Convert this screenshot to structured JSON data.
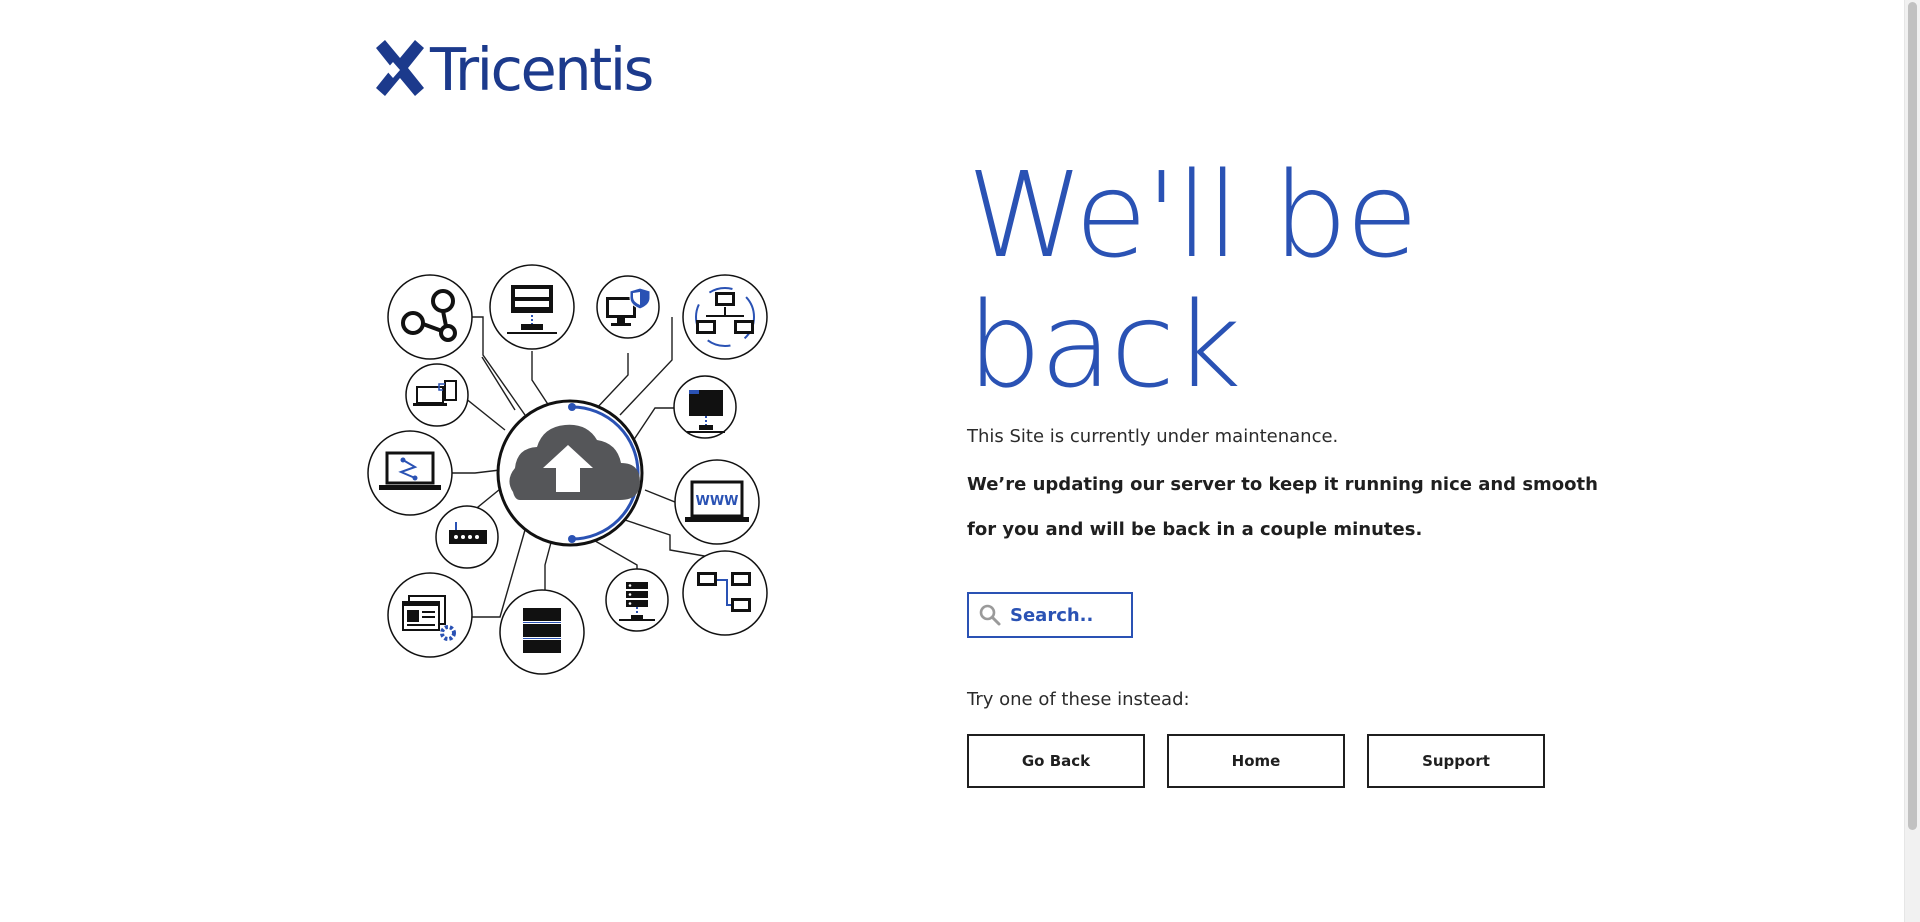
{
  "brand": {
    "name": "Tricentis",
    "color": "#1c3a8c"
  },
  "accent_color": "#2a52b4",
  "headline": {
    "line1": "We'll be",
    "line2": "back"
  },
  "message": {
    "status": "This Site is currently under maintenance.",
    "detail_line1": "We’re updating our server to keep it running nice and smooth",
    "detail_line2": "for you and will be back in a couple minutes."
  },
  "search": {
    "placeholder": "Search..",
    "icon": "search-icon"
  },
  "alternatives": {
    "prompt": "Try one of these instead:",
    "buttons": [
      {
        "label": "Go Back"
      },
      {
        "label": "Home"
      },
      {
        "label": "Support"
      }
    ]
  },
  "illustration": {
    "center_icon": "cloud-upload-icon",
    "node_icons": [
      "share-icon",
      "desktop-network-icon",
      "secure-monitor-icon",
      "network-sync-icon",
      "laptop-mobile-icon",
      "monitor-network-icon",
      "laptop-graph-icon",
      "www-laptop-icon",
      "router-icon",
      "network-computers-icon",
      "browser-windows-gear-icon",
      "server-stack-icon",
      "server-network-icon"
    ]
  }
}
